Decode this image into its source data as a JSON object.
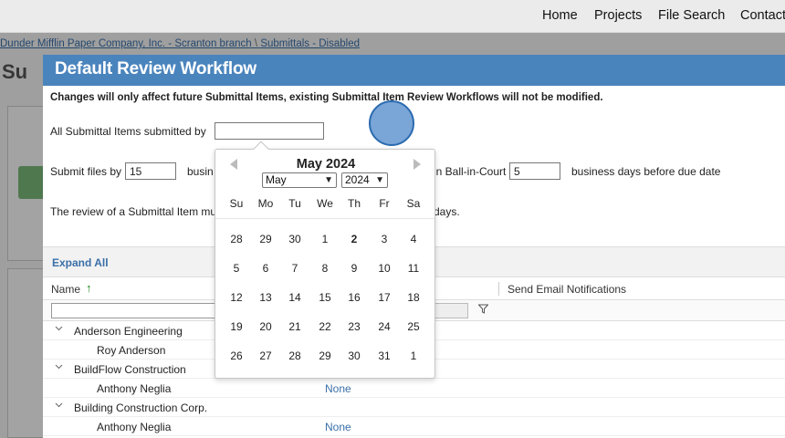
{
  "topnav": {
    "items": [
      "Home",
      "Projects",
      "File Search",
      "Contact"
    ]
  },
  "background": {
    "breadcrumb": [
      "Dunder Mifflin Paper Company, Inc. - Scranton branch",
      "\\",
      "Submittals - Disabled"
    ],
    "heading": "Su"
  },
  "dialog": {
    "title": "Default Review Workflow",
    "notice": "Changes will only affect future Submittal Items, existing Submittal Item Review Workflows will not be modified.",
    "submitted_by_label": "All Submittal Items submitted by",
    "submitted_by_value": "",
    "submit_files_label": "Submit files by",
    "submit_files_value": "15",
    "submit_files_suffix": "busin",
    "ball_in_court_label": "in Ball-in-Court",
    "ball_in_court_value": "5",
    "ball_in_court_suffix": "business days before due date",
    "review_label": "The review of a Submittal Item mu",
    "review_suffix": "days."
  },
  "grid": {
    "expand_all": "Expand All",
    "columns": {
      "name": "Name",
      "email": "Send Email Notifications"
    },
    "sort_icon": "↑",
    "rows": [
      {
        "type": "group",
        "label": "Anderson Engineering"
      },
      {
        "type": "child",
        "label": "Roy Anderson",
        "value": ""
      },
      {
        "type": "group",
        "label": "BuildFlow Construction"
      },
      {
        "type": "child",
        "label": "Anthony Neglia",
        "value": "None"
      },
      {
        "type": "group",
        "label": "Building Construction Corp."
      },
      {
        "type": "child",
        "label": "Anthony Neglia",
        "value": "None"
      }
    ]
  },
  "datepicker": {
    "title": "May 2024",
    "month_select": "May",
    "year_select": "2024",
    "prev_icon": "◀",
    "next_icon": "▶",
    "weekdays": [
      "Su",
      "Mo",
      "Tu",
      "We",
      "Th",
      "Fr",
      "Sa"
    ],
    "weeks": [
      [
        "28",
        "29",
        "30",
        "1",
        "2",
        "3",
        "4"
      ],
      [
        "5",
        "6",
        "7",
        "8",
        "9",
        "10",
        "11"
      ],
      [
        "12",
        "13",
        "14",
        "15",
        "16",
        "17",
        "18"
      ],
      [
        "19",
        "20",
        "21",
        "22",
        "23",
        "24",
        "25"
      ],
      [
        "26",
        "27",
        "28",
        "29",
        "30",
        "31",
        "1"
      ]
    ],
    "today": "2"
  },
  "colors": {
    "title_bar": "#4a84bd",
    "link": "#3a6fa8",
    "sort_arrow": "#1a8a1a"
  }
}
